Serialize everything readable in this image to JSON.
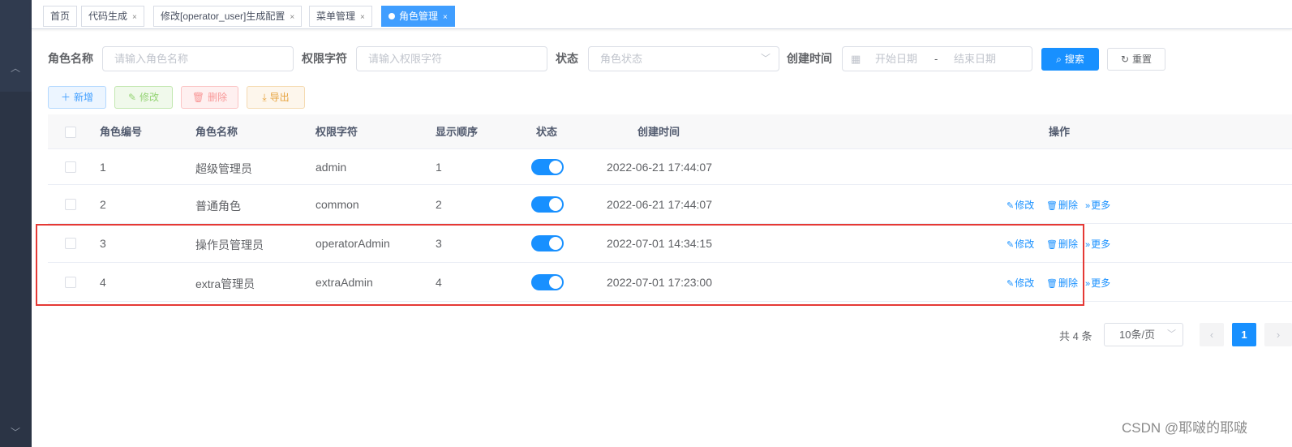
{
  "tags": [
    {
      "label": "首页"
    },
    {
      "label": "代码生成"
    },
    {
      "label": "修改[operator_user]生成配置"
    },
    {
      "label": "菜单管理"
    },
    {
      "label": "角色管理"
    }
  ],
  "search": {
    "role_name_label": "角色名称",
    "role_name_placeholder": "请输入角色名称",
    "role_key_label": "权限字符",
    "role_key_placeholder": "请输入权限字符",
    "status_label": "状态",
    "status_placeholder": "角色状态",
    "created_label": "创建时间",
    "start_placeholder": "开始日期",
    "range_separator": "-",
    "end_placeholder": "结束日期",
    "search_button": "搜索",
    "reset_button": "重置"
  },
  "toolbar": {
    "add": "新增",
    "edit": "修改",
    "delete": "删除",
    "export": "导出"
  },
  "table": {
    "columns": [
      "角色编号",
      "角色名称",
      "权限字符",
      "显示顺序",
      "状态",
      "创建时间",
      "操作"
    ],
    "rows": [
      {
        "id": "1",
        "name": "超级管理员",
        "key": "admin",
        "sort": "1",
        "status_on": true,
        "created": "2022-06-21 17:44:07"
      },
      {
        "id": "2",
        "name": "普通角色",
        "key": "common",
        "sort": "2",
        "status_on": true,
        "created": "2022-06-21 17:44:07"
      },
      {
        "id": "3",
        "name": "操作员管理员",
        "key": "operatorAdmin",
        "sort": "3",
        "status_on": true,
        "created": "2022-07-01 14:34:15"
      },
      {
        "id": "4",
        "name": "extra管理员",
        "key": "extraAdmin",
        "sort": "4",
        "status_on": true,
        "created": "2022-07-01 17:23:00"
      }
    ],
    "actions": {
      "edit": "修改",
      "delete": "删除",
      "more": "更多"
    }
  },
  "pagination": {
    "total_text": "共 4 条",
    "page_size": "10条/页",
    "current_page": "1"
  },
  "watermark": "CSDN @耶啵的耶啵",
  "colors": {
    "primary": "#1890ff",
    "sidebar": "#2b3445",
    "highlight": "#e53935"
  }
}
